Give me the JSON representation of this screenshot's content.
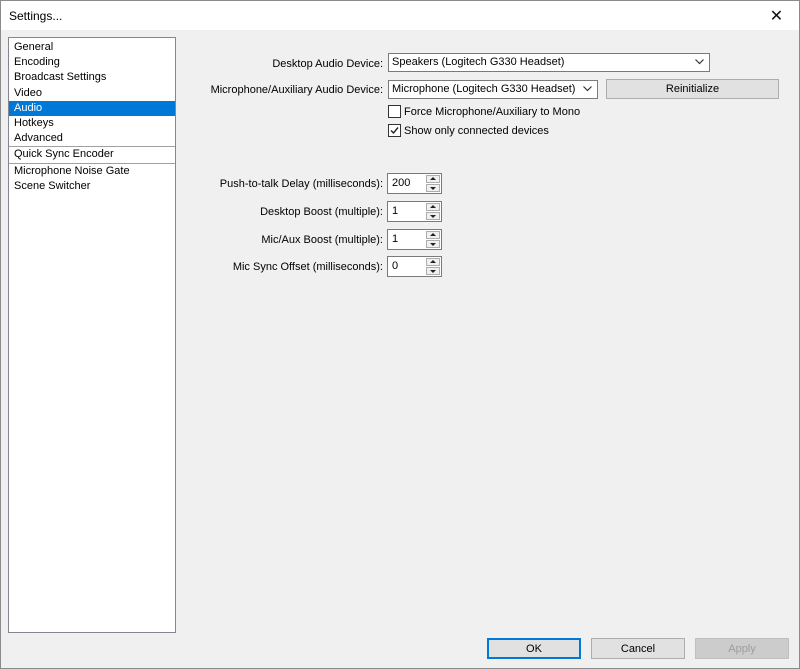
{
  "window": {
    "title": "Settings...",
    "close_glyph": "✕"
  },
  "sidebar": {
    "groups": [
      [
        "General",
        "Encoding",
        "Broadcast Settings",
        "Video",
        "Audio",
        "Hotkeys",
        "Advanced"
      ],
      [
        "Quick Sync Encoder"
      ],
      [
        "Microphone Noise Gate",
        "Scene Switcher"
      ]
    ],
    "selected": "Audio"
  },
  "audio": {
    "desktop_device_label": "Desktop Audio Device:",
    "desktop_device_value": "Speakers (Logitech G330 Headset)",
    "mic_device_label": "Microphone/Auxiliary Audio Device:",
    "mic_device_value": "Microphone (Logitech G330 Headset)",
    "reinitialize_label": "Reinitialize",
    "force_mono_label": "Force Microphone/Auxiliary to Mono",
    "force_mono_checked": false,
    "connected_only_label": "Show only connected devices",
    "connected_only_checked": true,
    "ptt_delay_label": "Push-to-talk Delay (milliseconds):",
    "ptt_delay_value": "200",
    "desktop_boost_label": "Desktop Boost (multiple):",
    "desktop_boost_value": "1",
    "mic_boost_label": "Mic/Aux Boost (multiple):",
    "mic_boost_value": "1",
    "mic_sync_label": "Mic Sync Offset (milliseconds):",
    "mic_sync_value": "0"
  },
  "footer": {
    "ok_label": "OK",
    "cancel_label": "Cancel",
    "apply_label": "Apply"
  }
}
